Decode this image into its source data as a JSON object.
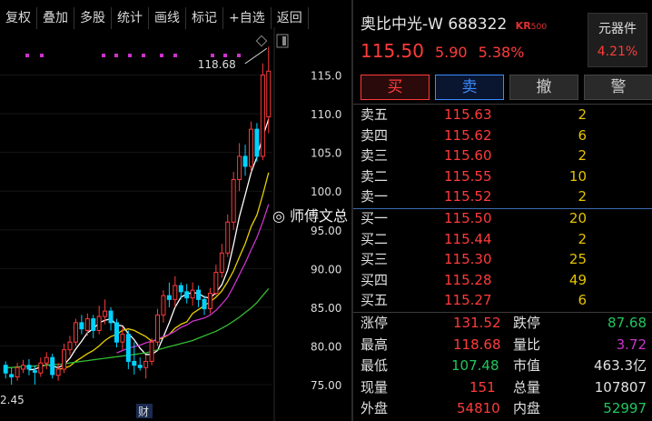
{
  "toolbar": {
    "items": [
      "复权",
      "叠加",
      "多股",
      "统计",
      "画线",
      "标记",
      "+自选",
      "返回"
    ]
  },
  "stock": {
    "name": "奥比中光-W",
    "code": "688322",
    "badge": "KR",
    "badge_sub": "500",
    "price": "115.50",
    "change": "5.90",
    "change_pct": "5.38%"
  },
  "sector": {
    "name": "元器件",
    "pct": "4.21%"
  },
  "actions": {
    "buy": "买",
    "sell": "卖",
    "cancel": "撤",
    "alert": "警"
  },
  "sells": [
    {
      "label": "卖五",
      "price": "115.63",
      "vol": "2"
    },
    {
      "label": "卖四",
      "price": "115.62",
      "vol": "6"
    },
    {
      "label": "卖三",
      "price": "115.60",
      "vol": "2"
    },
    {
      "label": "卖二",
      "price": "115.55",
      "vol": "10"
    },
    {
      "label": "卖一",
      "price": "115.52",
      "vol": "2"
    }
  ],
  "buys": [
    {
      "label": "买一",
      "price": "115.50",
      "vol": "20"
    },
    {
      "label": "买二",
      "price": "115.44",
      "vol": "2"
    },
    {
      "label": "买三",
      "price": "115.30",
      "vol": "25"
    },
    {
      "label": "买四",
      "price": "115.28",
      "vol": "49"
    },
    {
      "label": "买五",
      "price": "115.27",
      "vol": "6"
    }
  ],
  "stats": {
    "limit_up_label": "涨停",
    "limit_up": "131.52",
    "limit_down_label": "跌停",
    "limit_down": "87.68",
    "high_label": "最高",
    "high": "118.68",
    "vol_ratio_label": "量比",
    "vol_ratio": "3.72",
    "low_label": "最低",
    "low": "107.48",
    "mktcap_label": "市值",
    "mktcap": "463.3亿",
    "cur_vol_label": "现量",
    "cur_vol": "151",
    "total_vol_label": "总量",
    "total_vol": "107807",
    "outer_label": "外盘",
    "outer": "54810",
    "inner_label": "内盘",
    "inner": "52997"
  },
  "watermark": "师傅文总",
  "colors": {
    "up": "#ff3b3b",
    "down": "#00d2ff",
    "ma5": "#ffffff",
    "ma10": "#e6d000",
    "ma20": "#cc33cc",
    "ma60": "#33bb33",
    "volume_yellow": "#e6c200",
    "green": "#22c55e"
  },
  "chart_data": {
    "type": "candlestick",
    "y_ticks": [
      "115.0",
      "110.0",
      "105.0",
      "100.0",
      "95.00",
      "90.00",
      "85.00",
      "80.00",
      "75.00"
    ],
    "y_range": [
      73.0,
      120.0
    ],
    "high_annotation": "118.68",
    "low_annotation": "2.45",
    "footer_marker": "财",
    "candles": [
      [
        77.5,
        76.5,
        78.0,
        75.8
      ],
      [
        76.3,
        76.0,
        77.2,
        75.0
      ],
      [
        76.0,
        77.2,
        77.8,
        75.5
      ],
      [
        77.0,
        77.5,
        78.2,
        76.5
      ],
      [
        77.5,
        77.0,
        78.3,
        76.2
      ],
      [
        76.8,
        76.6,
        77.5,
        75.0
      ],
      [
        76.5,
        77.8,
        78.5,
        76.0
      ],
      [
        77.8,
        78.5,
        79.2,
        77.0
      ],
      [
        78.5,
        76.3,
        79.0,
        75.8
      ],
      [
        76.2,
        77.0,
        77.8,
        75.5
      ],
      [
        77.0,
        79.5,
        80.3,
        76.5
      ],
      [
        79.5,
        80.5,
        81.3,
        78.8
      ],
      [
        80.5,
        83.0,
        83.5,
        80.0
      ],
      [
        83.0,
        82.2,
        84.0,
        81.5
      ],
      [
        82.0,
        83.5,
        84.2,
        81.3
      ],
      [
        83.5,
        82.0,
        84.0,
        81.0
      ],
      [
        82.0,
        83.8,
        85.2,
        81.5
      ],
      [
        83.8,
        84.5,
        86.0,
        82.8
      ],
      [
        84.5,
        83.0,
        85.0,
        82.0
      ],
      [
        83.0,
        80.5,
        83.5,
        79.8
      ],
      [
        80.5,
        81.5,
        82.5,
        79.5
      ],
      [
        81.5,
        78.0,
        82.0,
        77.0
      ],
      [
        78.0,
        77.5,
        80.5,
        76.3
      ],
      [
        77.5,
        77.2,
        78.5,
        76.8
      ],
      [
        77.2,
        78.0,
        78.8,
        75.8
      ],
      [
        78.0,
        80.5,
        81.0,
        77.5
      ],
      [
        80.5,
        84.0,
        84.8,
        80.0
      ],
      [
        84.0,
        86.5,
        87.2,
        83.0
      ],
      [
        86.5,
        86.0,
        88.2,
        85.0
      ],
      [
        86.0,
        87.8,
        89.0,
        85.0
      ],
      [
        87.8,
        87.0,
        88.2,
        86.0
      ],
      [
        87.0,
        86.2,
        88.0,
        85.5
      ],
      [
        86.2,
        87.2,
        88.2,
        85.2
      ],
      [
        87.2,
        86.0,
        87.8,
        85.0
      ],
      [
        86.0,
        84.8,
        86.5,
        84.0
      ],
      [
        84.8,
        86.8,
        87.5,
        84.2
      ],
      [
        86.8,
        89.5,
        90.5,
        86.5
      ],
      [
        89.5,
        92.0,
        93.2,
        88.8
      ],
      [
        92.0,
        96.0,
        97.0,
        91.5
      ],
      [
        96.0,
        101.5,
        102.5,
        95.0
      ],
      [
        101.5,
        104.5,
        106.2,
        100.0
      ],
      [
        104.5,
        103.2,
        106.0,
        102.0
      ],
      [
        103.2,
        108.0,
        109.0,
        102.5
      ],
      [
        108.0,
        104.5,
        108.8,
        103.8
      ],
      [
        104.5,
        115.0,
        116.5,
        104.0
      ],
      [
        109.6,
        115.5,
        118.68,
        107.48
      ]
    ],
    "mas": [
      {
        "name": "MA5",
        "color": "#ffffff",
        "values": [
          null,
          null,
          null,
          null,
          76.9,
          77.0,
          77.3,
          77.6,
          77.4,
          77.2,
          77.6,
          78.4,
          79.6,
          80.6,
          81.7,
          82.2,
          83.0,
          83.3,
          83.5,
          82.7,
          82.6,
          81.6,
          80.8,
          79.7,
          78.9,
          78.9,
          79.4,
          81.2,
          83.0,
          85.0,
          86.3,
          86.7,
          86.9,
          86.8,
          86.3,
          86.2,
          86.9,
          87.9,
          89.8,
          93.1,
          96.7,
          99.5,
          102.4,
          104.4,
          107.0,
          109.3
        ]
      },
      {
        "name": "MA10",
        "color": "#e6d000",
        "values": [
          null,
          null,
          null,
          null,
          null,
          null,
          null,
          null,
          null,
          77.0,
          77.1,
          77.4,
          78.0,
          78.5,
          79.0,
          79.4,
          80.0,
          80.7,
          81.2,
          81.5,
          82.0,
          82.2,
          82.0,
          81.6,
          81.2,
          80.6,
          80.8,
          81.1,
          81.5,
          82.3,
          82.8,
          83.1,
          84.2,
          84.7,
          85.2,
          85.7,
          86.3,
          87.1,
          88.3,
          89.7,
          91.5,
          93.2,
          95.4,
          96.9,
          99.5,
          102.4
        ]
      },
      {
        "name": "MA20",
        "color": "#cc33cc",
        "values": [
          null,
          null,
          null,
          null,
          null,
          null,
          null,
          null,
          null,
          null,
          null,
          null,
          null,
          null,
          null,
          null,
          null,
          null,
          null,
          79.1,
          79.4,
          79.7,
          79.9,
          80.1,
          80.4,
          80.6,
          80.9,
          81.2,
          81.5,
          81.9,
          82.4,
          82.7,
          83.2,
          83.4,
          83.6,
          84.0,
          84.6,
          85.4,
          86.3,
          87.7,
          89.2,
          90.7,
          92.4,
          94.0,
          96.0,
          98.3
        ]
      },
      {
        "name": "MA60",
        "color": "#33bb33",
        "values": [
          77.2,
          77.2,
          77.3,
          77.3,
          77.4,
          77.4,
          77.5,
          77.5,
          77.6,
          77.6,
          77.7,
          77.8,
          77.9,
          78.0,
          78.1,
          78.2,
          78.3,
          78.4,
          78.5,
          78.6,
          78.7,
          78.8,
          78.9,
          79.0,
          79.1,
          79.3,
          79.5,
          79.7,
          79.9,
          80.1,
          80.3,
          80.5,
          80.7,
          81.0,
          81.3,
          81.6,
          81.9,
          82.3,
          82.7,
          83.2,
          83.7,
          84.3,
          84.9,
          85.6,
          86.5,
          87.4
        ]
      }
    ]
  }
}
